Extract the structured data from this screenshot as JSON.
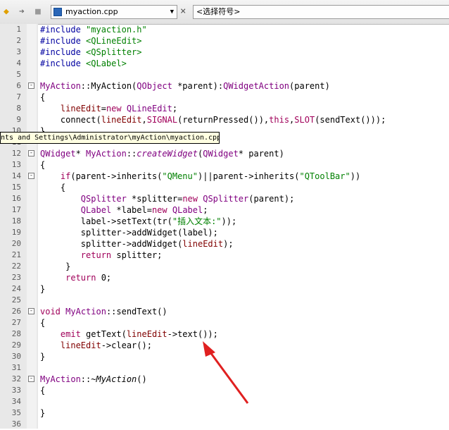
{
  "toolbar": {
    "back_icon": "back-arrow-icon",
    "forward_icon": "forward-arrow-icon",
    "lock_icon": "lock-icon",
    "file_label": "myaction.cpp",
    "close_label": "×",
    "symbol_label": "<选择符号>"
  },
  "tooltip": "nts and Settings\\Administrator\\myAction\\myaction.cpp",
  "colors": {
    "keyword": "#a0005a",
    "string": "#008000",
    "type": "#800080",
    "gutter": "#e8e8e8",
    "arrow": "#e02020"
  },
  "lines": [
    {
      "n": "1",
      "fold": "",
      "segs": [
        [
          "#include ",
          "#0000a0"
        ],
        [
          "\"myaction.h\"",
          "#008000"
        ]
      ]
    },
    {
      "n": "2",
      "fold": "",
      "segs": [
        [
          "#include ",
          "#0000a0"
        ],
        [
          "<QLineEdit>",
          "#008000"
        ]
      ]
    },
    {
      "n": "3",
      "fold": "",
      "segs": [
        [
          "#include ",
          "#0000a0"
        ],
        [
          "<QSplitter>",
          "#008000"
        ]
      ]
    },
    {
      "n": "4",
      "fold": "",
      "segs": [
        [
          "#include ",
          "#0000a0"
        ],
        [
          "<QLabel>",
          "#008000"
        ]
      ]
    },
    {
      "n": "5",
      "fold": "",
      "segs": []
    },
    {
      "n": "6",
      "fold": "-",
      "segs": [
        [
          "MyAction",
          "#800080"
        ],
        [
          "::MyAction(",
          "#000000"
        ],
        [
          "QObject",
          "#800080"
        ],
        [
          " *parent):",
          "#000000"
        ],
        [
          "QWidgetAction",
          "#800080"
        ],
        [
          "(parent)",
          "#000000"
        ]
      ]
    },
    {
      "n": "7",
      "fold": "",
      "segs": [
        [
          "{",
          "#000000"
        ]
      ]
    },
    {
      "n": "8",
      "fold": "",
      "segs": [
        [
          "    lineEdit",
          "#800000"
        ],
        [
          "=",
          "#000000"
        ],
        [
          "new",
          "#a0005a"
        ],
        [
          " ",
          "#000000"
        ],
        [
          "QLineEdit",
          "#800080"
        ],
        [
          ";",
          "#000000"
        ]
      ]
    },
    {
      "n": "9",
      "fold": "",
      "segs": [
        [
          "    connect(",
          "#000000"
        ],
        [
          "lineEdit",
          "#800000"
        ],
        [
          ",",
          "#000000"
        ],
        [
          "SIGNAL",
          "#a0005a"
        ],
        [
          "(returnPressed()),",
          "#000000"
        ],
        [
          "this",
          "#a0005a"
        ],
        [
          ",",
          "#000000"
        ],
        [
          "SLOT",
          "#a0005a"
        ],
        [
          "(sendText()));",
          "#000000"
        ]
      ]
    },
    {
      "n": "10",
      "fold": "",
      "segs": [
        [
          "}",
          "#000000"
        ]
      ]
    },
    {
      "n": "11",
      "fold": "",
      "segs": []
    },
    {
      "n": "12",
      "fold": "-",
      "segs": [
        [
          "QWidget",
          "#800080"
        ],
        [
          "* ",
          "#000000"
        ],
        [
          "MyAction",
          "#800080"
        ],
        [
          "::",
          "#000000"
        ],
        [
          "createWidget",
          "#800080",
          "italic"
        ],
        [
          "(",
          "#000000"
        ],
        [
          "QWidget",
          "#800080"
        ],
        [
          "* parent)",
          "#000000"
        ]
      ]
    },
    {
      "n": "13",
      "fold": "",
      "segs": [
        [
          "{",
          "#000000"
        ]
      ]
    },
    {
      "n": "14",
      "fold": "-",
      "segs": [
        [
          "    if",
          "#a0005a"
        ],
        [
          "(parent->inherits(",
          "#000000"
        ],
        [
          "\"QMenu\"",
          "#008000"
        ],
        [
          ")||parent->inherits(",
          "#000000"
        ],
        [
          "\"QToolBar\"",
          "#008000"
        ],
        [
          "))",
          "#000000"
        ]
      ]
    },
    {
      "n": "15",
      "fold": "",
      "segs": [
        [
          "    {",
          "#000000"
        ]
      ]
    },
    {
      "n": "16",
      "fold": "",
      "segs": [
        [
          "        QSplitter",
          "#800080"
        ],
        [
          " *splitter=",
          "#000000"
        ],
        [
          "new",
          "#a0005a"
        ],
        [
          " ",
          "#000000"
        ],
        [
          "QSplitter",
          "#800080"
        ],
        [
          "(parent);",
          "#000000"
        ]
      ]
    },
    {
      "n": "17",
      "fold": "",
      "segs": [
        [
          "        QLabel",
          "#800080"
        ],
        [
          " *label=",
          "#000000"
        ],
        [
          "new",
          "#a0005a"
        ],
        [
          " ",
          "#000000"
        ],
        [
          "QLabel",
          "#800080"
        ],
        [
          ";",
          "#000000"
        ]
      ]
    },
    {
      "n": "18",
      "fold": "",
      "segs": [
        [
          "        label->setText(tr(",
          "#000000"
        ],
        [
          "\"插入文本:\"",
          "#008000"
        ],
        [
          "));",
          "#000000"
        ]
      ]
    },
    {
      "n": "19",
      "fold": "",
      "segs": [
        [
          "        splitter->addWidget(label);",
          "#000000"
        ]
      ]
    },
    {
      "n": "20",
      "fold": "",
      "segs": [
        [
          "        splitter->addWidget(",
          "#000000"
        ],
        [
          "lineEdit",
          "#800000"
        ],
        [
          ");",
          "#000000"
        ]
      ]
    },
    {
      "n": "21",
      "fold": "",
      "segs": [
        [
          "        return",
          "#a0005a"
        ],
        [
          " splitter;",
          "#000000"
        ]
      ]
    },
    {
      "n": "22",
      "fold": "",
      "segs": [
        [
          "     }",
          "#000000"
        ]
      ]
    },
    {
      "n": "23",
      "fold": "",
      "segs": [
        [
          "     return",
          "#a0005a"
        ],
        [
          " 0;",
          "#000000"
        ]
      ]
    },
    {
      "n": "24",
      "fold": "",
      "segs": [
        [
          "}",
          "#000000"
        ]
      ]
    },
    {
      "n": "25",
      "fold": "",
      "segs": []
    },
    {
      "n": "26",
      "fold": "-",
      "segs": [
        [
          "void",
          "#a0005a"
        ],
        [
          " ",
          "#000000"
        ],
        [
          "MyAction",
          "#800080"
        ],
        [
          "::sendText()",
          "#000000"
        ]
      ]
    },
    {
      "n": "27",
      "fold": "",
      "segs": [
        [
          "{",
          "#000000"
        ]
      ]
    },
    {
      "n": "28",
      "fold": "",
      "segs": [
        [
          "    emit",
          "#a0005a"
        ],
        [
          " getText(",
          "#000000"
        ],
        [
          "lineEdit",
          "#800000"
        ],
        [
          "->text());",
          "#000000"
        ]
      ]
    },
    {
      "n": "29",
      "fold": "",
      "segs": [
        [
          "    lineEdit",
          "#800000"
        ],
        [
          "->clear();",
          "#000000"
        ]
      ]
    },
    {
      "n": "30",
      "fold": "",
      "segs": [
        [
          "}",
          "#000000"
        ]
      ]
    },
    {
      "n": "31",
      "fold": "",
      "segs": []
    },
    {
      "n": "32",
      "fold": "-",
      "segs": [
        [
          "MyAction",
          "#800080"
        ],
        [
          "::~",
          "#000000"
        ],
        [
          "MyAction",
          "#000000",
          "italic"
        ],
        [
          "()",
          "#000000"
        ]
      ]
    },
    {
      "n": "33",
      "fold": "",
      "segs": [
        [
          "{",
          "#000000"
        ]
      ]
    },
    {
      "n": "34",
      "fold": "",
      "segs": []
    },
    {
      "n": "35",
      "fold": "",
      "segs": [
        [
          "}",
          "#000000"
        ]
      ]
    },
    {
      "n": "36",
      "fold": "",
      "segs": []
    }
  ]
}
